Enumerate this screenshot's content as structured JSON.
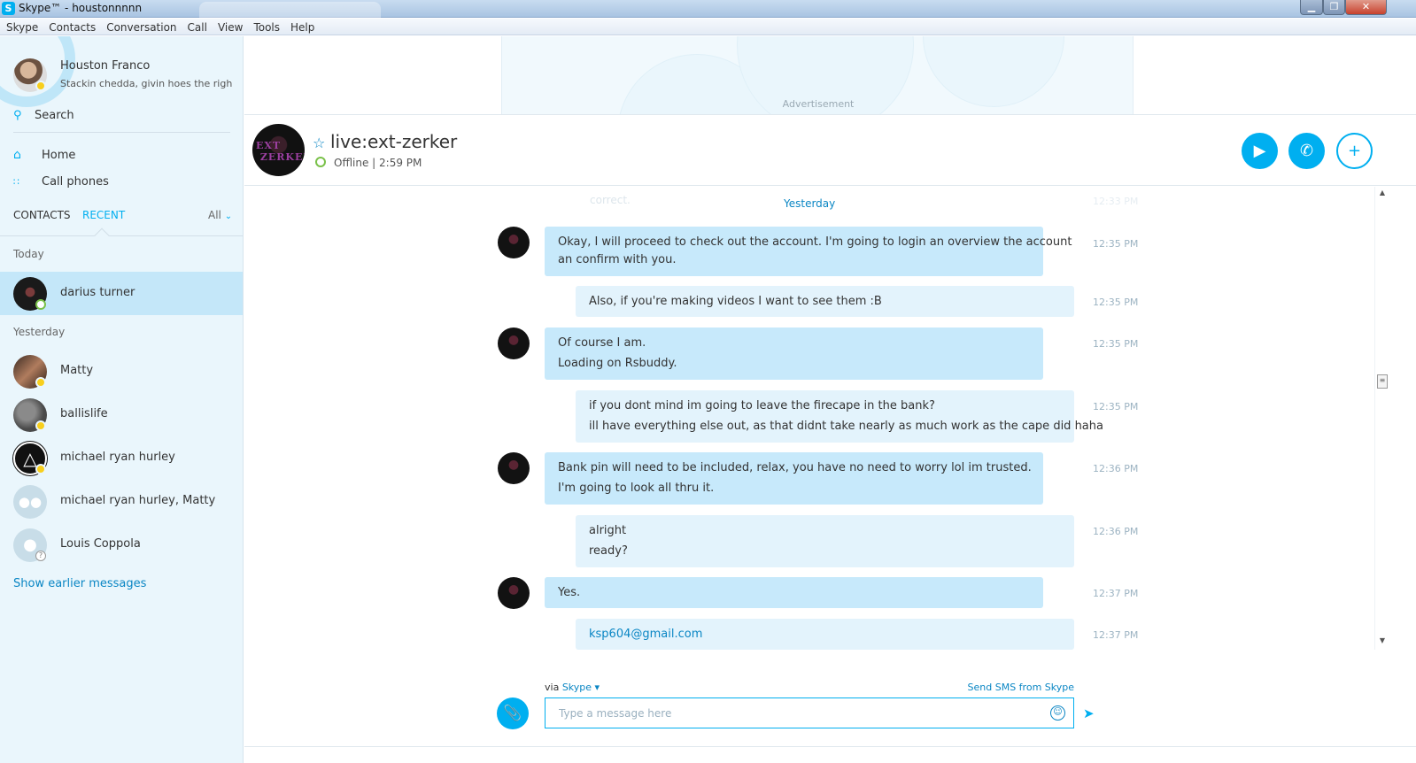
{
  "window": {
    "title": "Skype™ - houstonnnnn",
    "app_icon": "S"
  },
  "menu": [
    "Skype",
    "Contacts",
    "Conversation",
    "Call",
    "View",
    "Tools",
    "Help"
  ],
  "profile": {
    "name": "Houston Franco",
    "mood": "Stackin chedda, givin hoes the righ...",
    "status": "away"
  },
  "search": {
    "label": "Search",
    "icon": "search-icon"
  },
  "nav": [
    {
      "label": "Home",
      "icon": "home-icon"
    },
    {
      "label": "Call phones",
      "icon": "dialpad-icon"
    }
  ],
  "tabs": {
    "contacts": "CONTACTS",
    "recent": "RECENT",
    "filter": "All"
  },
  "recent": {
    "today_label": "Today",
    "yesterday_label": "Yesterday",
    "today": [
      {
        "name": "darius turner",
        "status": "online"
      }
    ],
    "yesterday": [
      {
        "name": "Matty",
        "status": "away"
      },
      {
        "name": "ballislife",
        "status": "away"
      },
      {
        "name": "michael ryan hurley",
        "status": "away"
      },
      {
        "name": "michael ryan hurley, Matty",
        "status": "group"
      },
      {
        "name": "Louis Coppola",
        "status": "unknown"
      }
    ],
    "show_earlier": "Show earlier messages"
  },
  "ad": {
    "label": "Advertisement"
  },
  "conversation": {
    "title": "live:ext-zerker",
    "presence": "Offline",
    "time": "2:59 PM",
    "status_line": "Offline | 2:59 PM",
    "avatar_text": "EXT ZERKER",
    "actions": {
      "video": "video-call-icon",
      "call": "phone-icon",
      "add": "add-person-icon"
    }
  },
  "chat": {
    "faded_top": "correct.",
    "faded_time": "12:33 PM",
    "day_label": "Yesterday",
    "messages": [
      {
        "dir": "in",
        "lines": [
          "Okay, I will proceed to check out the account. I'm going to login an overview the account",
          "an confirm with you."
        ],
        "time": "12:35 PM"
      },
      {
        "dir": "out",
        "lines": [
          "Also, if you're making videos I want to see them :B"
        ],
        "time": "12:35 PM"
      },
      {
        "dir": "in",
        "lines": [
          "Of course I am.",
          "Loading on Rsbuddy."
        ],
        "time": "12:35 PM"
      },
      {
        "dir": "out",
        "lines": [
          "if you dont mind im going to leave the firecape in the bank?",
          "ill have everything else out, as that didnt take nearly as much work as the cape did haha"
        ],
        "time": "12:35 PM"
      },
      {
        "dir": "in",
        "lines": [
          "Bank pin will need to be included, relax, you have no need to worry lol im trusted.",
          "I'm going to look all thru it."
        ],
        "time": "12:36 PM"
      },
      {
        "dir": "out",
        "lines": [
          "alright",
          "ready?"
        ],
        "time": "12:36 PM"
      },
      {
        "dir": "in",
        "lines": [
          "Yes."
        ],
        "time": "12:37 PM"
      },
      {
        "dir": "out",
        "lines": [
          "ksp604@gmail.com"
        ],
        "time": "12:37 PM",
        "is_link": true
      }
    ]
  },
  "composer": {
    "via_prefix": "via",
    "via_service": "Skype ▾",
    "send_sms": "Send SMS from Skype",
    "placeholder": "Type a message here"
  },
  "colors": {
    "accent": "#00aff0",
    "bubble_in": "#c7e9fb",
    "bubble_out": "#e3f3fc",
    "sidebar": "#eaf6fc"
  }
}
